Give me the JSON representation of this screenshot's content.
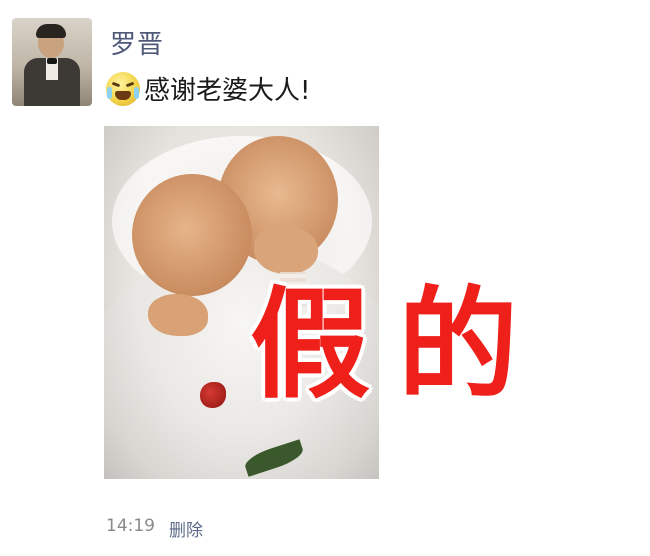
{
  "post": {
    "author": "罗晋",
    "message": "感谢老婆大人!",
    "emoji": "crying-face-icon",
    "image_alt": "two newborn babies wrapped in white blanket",
    "overlay_text": "假的",
    "time": "14:19",
    "delete_label": "删除"
  },
  "colors": {
    "name": "#4e5a78",
    "overlay": "#ef1f1a",
    "meta": "#8a8a8a"
  }
}
